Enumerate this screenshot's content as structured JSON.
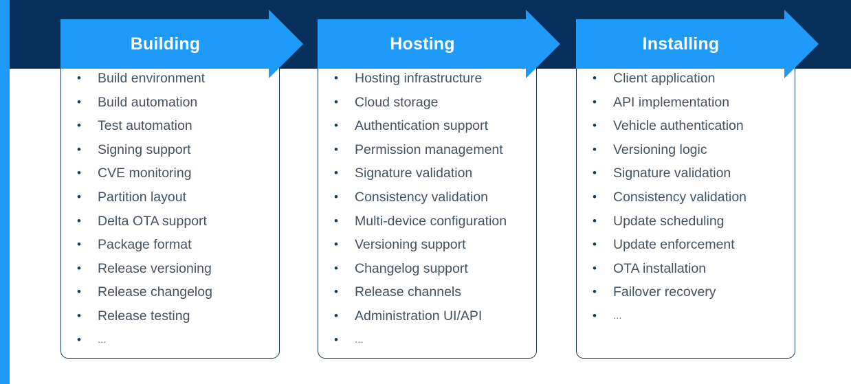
{
  "theme": {
    "accent_blue": "#1e9bfa",
    "navy": "#06305a",
    "card_border": "#12385c",
    "text": "#44515f",
    "header_text": "#ffffff",
    "background": "#ffffff"
  },
  "diagram": {
    "type": "process-flow-arrows",
    "stage_count": 3,
    "stages": [
      {
        "title": "Building",
        "items": [
          "Build environment",
          "Build automation",
          "Test automation",
          "Signing support",
          "CVE monitoring",
          "Partition layout",
          "Delta OTA support",
          "Package format",
          "Release versioning",
          "Release changelog",
          "Release testing",
          "..."
        ]
      },
      {
        "title": "Hosting",
        "items": [
          "Hosting infrastructure",
          "Cloud storage",
          "Authentication support",
          "Permission management",
          "Signature validation",
          "Consistency validation",
          "Multi-device configuration",
          "Versioning support",
          "Changelog support",
          "Release channels",
          "Administration UI/API",
          "..."
        ]
      },
      {
        "title": "Installing",
        "items": [
          "Client application",
          "API implementation",
          "Vehicle authentication",
          "Versioning logic",
          "Signature validation",
          "Consistency validation",
          "Update scheduling",
          "Update enforcement",
          "OTA installation",
          "Failover recovery",
          "..."
        ]
      }
    ]
  }
}
